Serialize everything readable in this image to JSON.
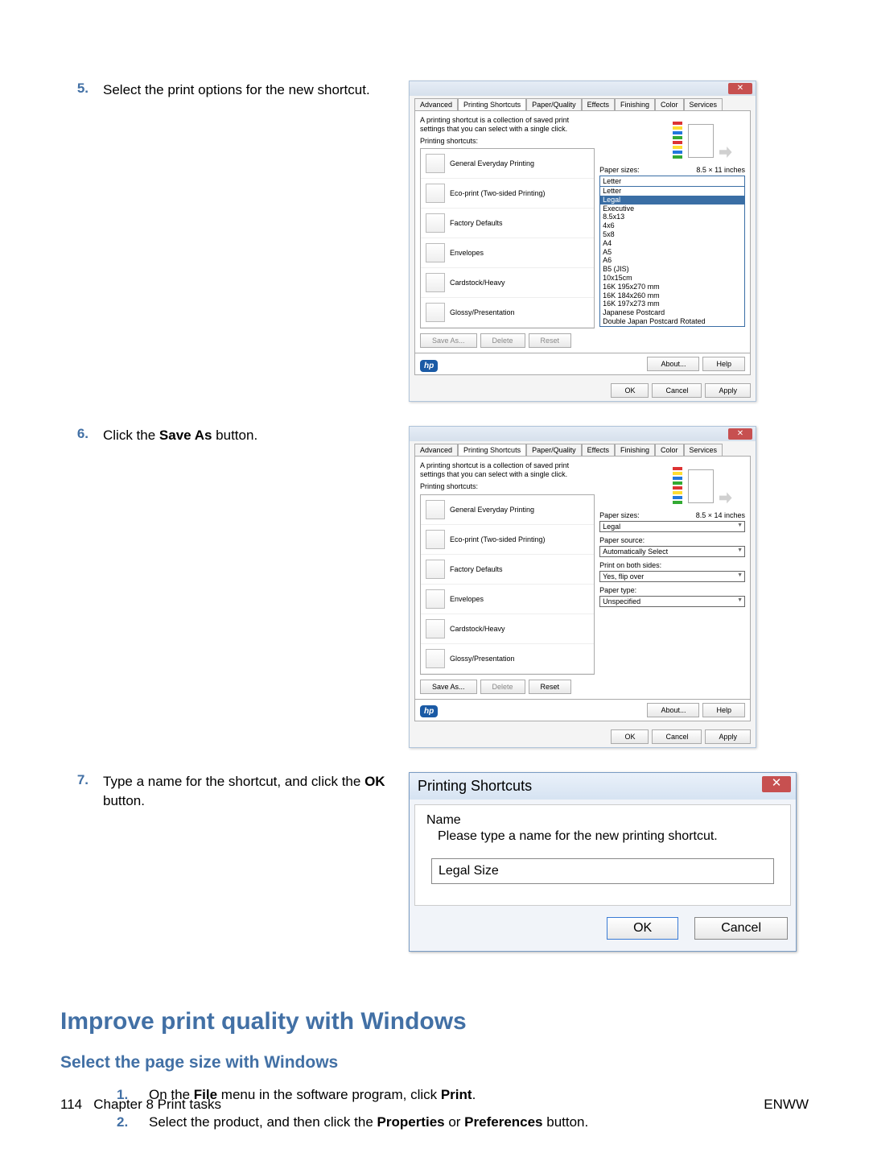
{
  "steps": {
    "5": {
      "num": "5.",
      "text_before": "Select the print options for the new shortcut."
    },
    "6": {
      "num": "6.",
      "text_a": "Click the ",
      "bold": "Save As",
      "text_b": " button."
    },
    "7": {
      "num": "7.",
      "text_a": "Type a name for the shortcut, and click the ",
      "bold": "OK",
      "text_b": " button."
    }
  },
  "dlg1": {
    "tabs": [
      "Advanced",
      "Printing Shortcuts",
      "Paper/Quality",
      "Effects",
      "Finishing",
      "Color",
      "Services"
    ],
    "desc": "A printing shortcut is a collection of saved print settings that you can select with a single click.",
    "list_label": "Printing shortcuts:",
    "shortcuts": [
      "General Everyday Printing",
      "Eco-print (Two-sided Printing)",
      "Factory Defaults",
      "Envelopes",
      "Cardstock/Heavy",
      "Glossy/Presentation"
    ],
    "save_as": "Save As...",
    "delete": "Delete",
    "reset": "Reset",
    "paper_sizes_label": "Paper sizes:",
    "paper_size_inches": "8.5 × 11 inches",
    "paper_size_sel": "Letter",
    "paper_options": [
      "Letter",
      "Legal",
      "Executive",
      "8.5x13",
      "4x6",
      "5x8",
      "A4",
      "A5",
      "A6",
      "B5 (JIS)",
      "10x15cm",
      "16K 195x270 mm",
      "16K 184x260 mm",
      "16K 197x273 mm",
      "Japanese Postcard",
      "Double Japan Postcard Rotated"
    ],
    "about": "About...",
    "help": "Help",
    "ok": "OK",
    "cancel": "Cancel",
    "apply": "Apply"
  },
  "dlg2": {
    "paper_size_inches": "8.5 × 14 inches",
    "paper_size_val": "Legal",
    "paper_source_label": "Paper source:",
    "paper_source_val": "Automatically Select",
    "both_sides_label": "Print on both sides:",
    "both_sides_val": "Yes, flip over",
    "paper_type_label": "Paper type:",
    "paper_type_val": "Unspecified"
  },
  "name_dlg": {
    "title": "Printing Shortcuts",
    "name_label": "Name",
    "prompt": "Please type a name for the new printing shortcut.",
    "input_value": "Legal Size",
    "ok": "OK",
    "cancel": "Cancel"
  },
  "section_heading": "Improve print quality with Windows",
  "sub_heading": "Select the page size with Windows",
  "inner_steps": {
    "1": {
      "num": "1.",
      "a": "On the ",
      "b1": "File",
      "c": " menu in the software program, click ",
      "b2": "Print",
      "d": "."
    },
    "2": {
      "num": "2.",
      "a": "Select the product, and then click the ",
      "b1": "Properties",
      "c": " or ",
      "b2": "Preferences",
      "d": " button."
    }
  },
  "footer": {
    "page_num": "114",
    "chapter": "Chapter 8   Print tasks",
    "right": "ENWW"
  }
}
